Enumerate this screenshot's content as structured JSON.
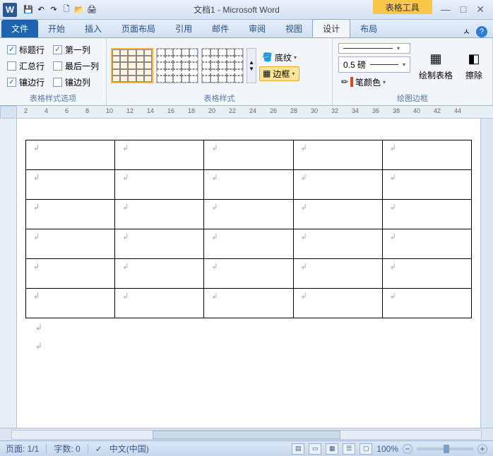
{
  "titlebar": {
    "app_letter": "W",
    "doc_title": "文档1 - Microsoft Word",
    "context_tab": "表格工具"
  },
  "qat": {
    "save": "💾",
    "undo": "↶",
    "redo": "↷",
    "new": "🗋",
    "open": "📂",
    "print": "🖨"
  },
  "win": {
    "min": "—",
    "max": "□",
    "close": "✕"
  },
  "tabs": {
    "file": "文件",
    "home": "开始",
    "insert": "插入",
    "layout": "页面布局",
    "ref": "引用",
    "mail": "邮件",
    "review": "审阅",
    "view": "视图",
    "design": "设计",
    "tlayout": "布局"
  },
  "help": {
    "expand": "ㅅ",
    "q": "?"
  },
  "group1": {
    "title": "表格样式选项",
    "header_row": "标题行",
    "first_col": "第一列",
    "total_row": "汇总行",
    "last_col": "最后一列",
    "banded_row": "镶边行",
    "banded_col": "镶边列"
  },
  "group2": {
    "title": "表格样式",
    "shading": "底纹",
    "borders": "边框"
  },
  "group3": {
    "title": "绘图边框",
    "weight": "0.5 磅",
    "pen_color": "笔颜色",
    "draw": "绘制表格",
    "erase": "擦除"
  },
  "ruler": {
    "marks": [
      "2",
      "4",
      "6",
      "8",
      "10",
      "12",
      "14",
      "16",
      "18",
      "20",
      "22",
      "24",
      "26",
      "28",
      "30",
      "32",
      "34",
      "36",
      "38",
      "40",
      "42",
      "44"
    ]
  },
  "table": {
    "rows": 6,
    "cols": 5,
    "cell_mark": "↲"
  },
  "para_marks": [
    "↲",
    "↲"
  ],
  "status": {
    "page": "页面: 1/1",
    "words": "字数: 0",
    "lang": "中文(中国)",
    "zoom": "100%",
    "minus": "−",
    "plus": "+"
  }
}
